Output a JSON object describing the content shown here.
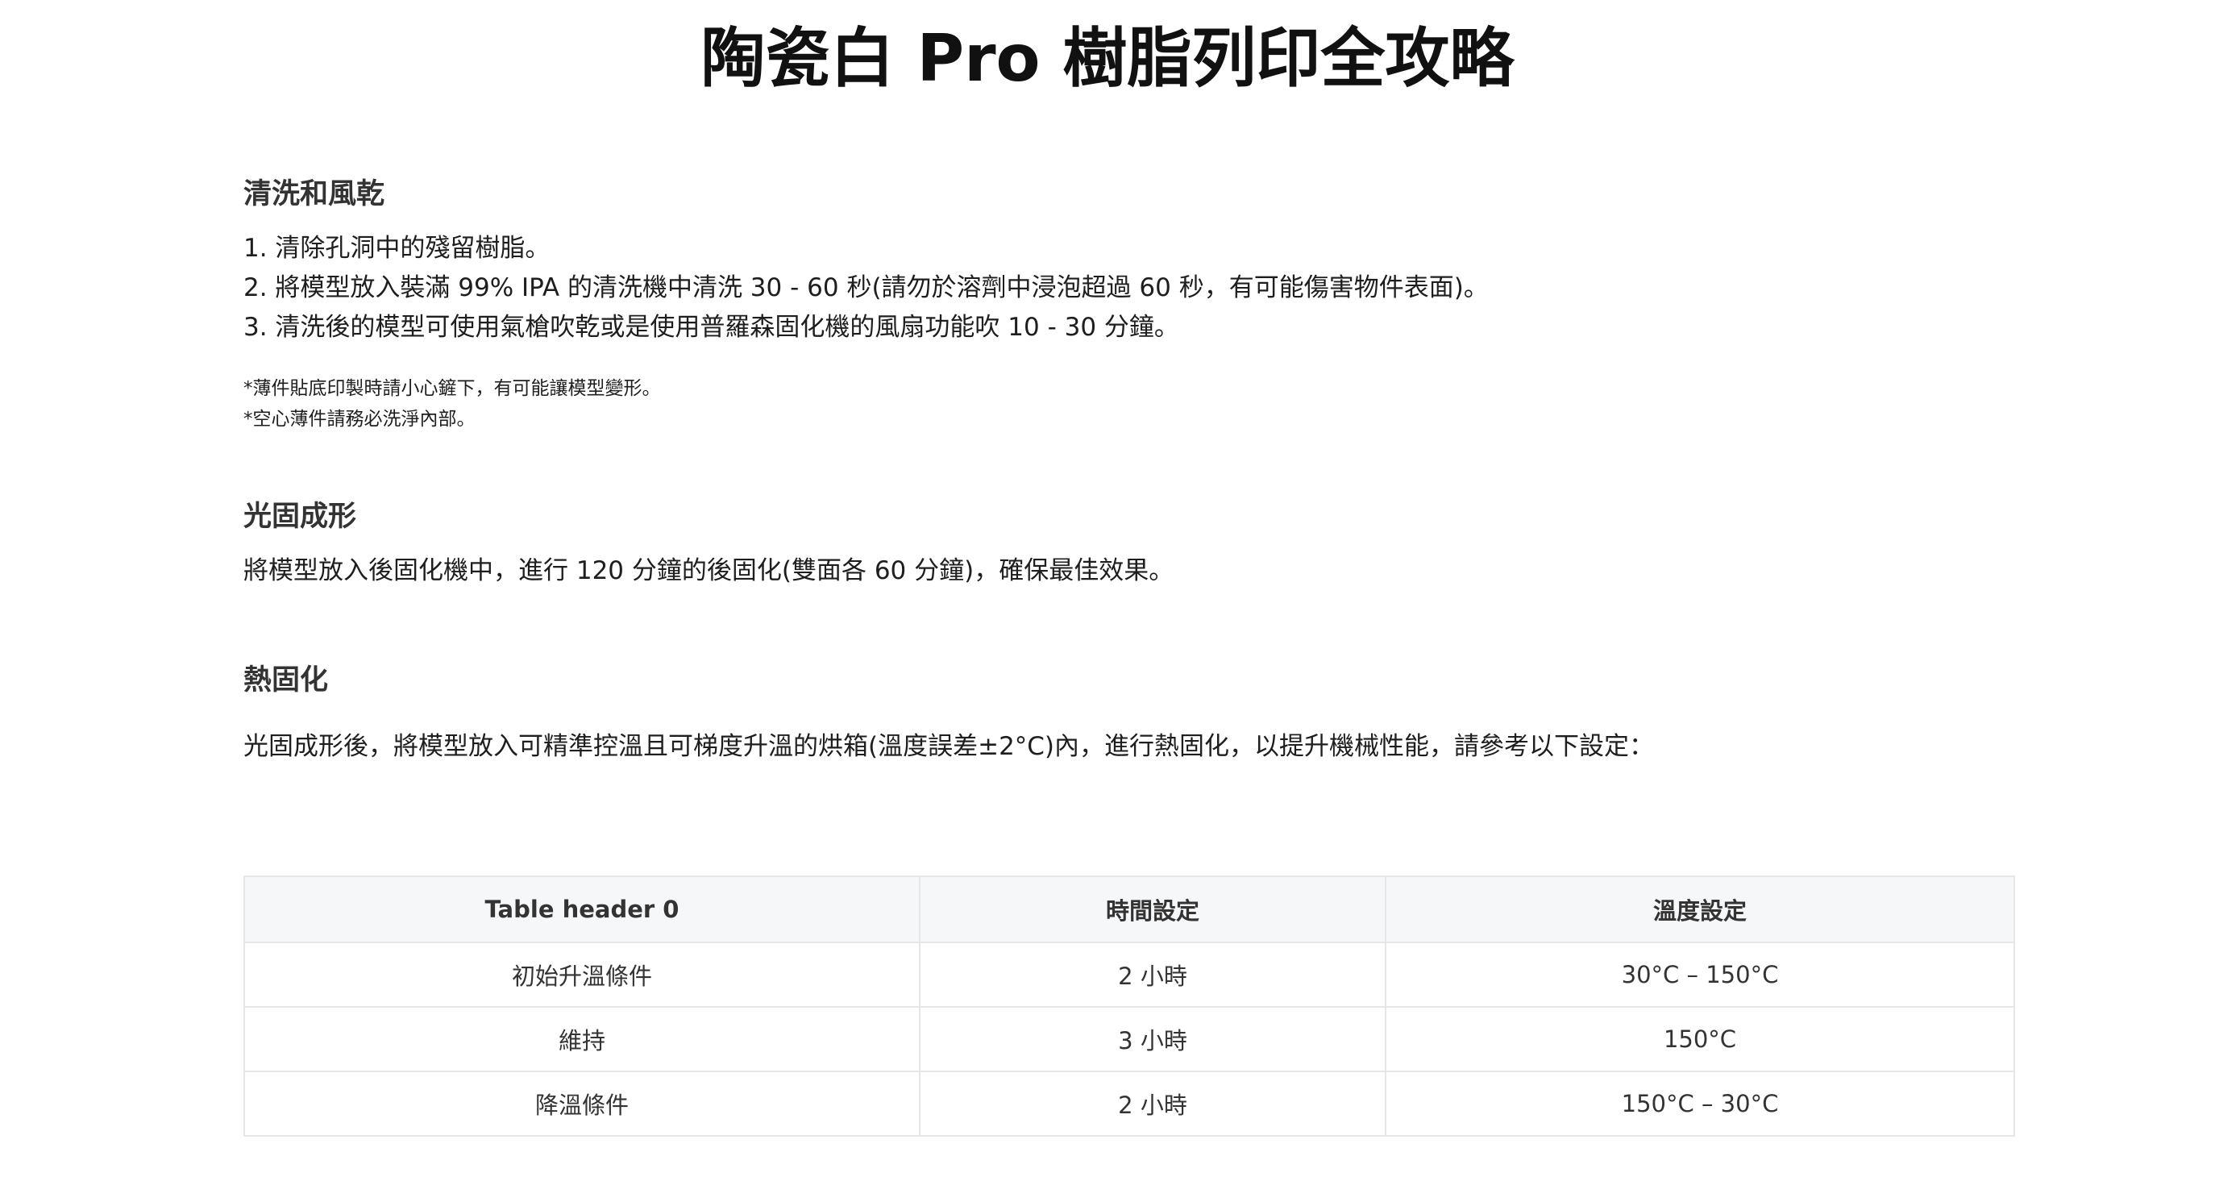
{
  "title": "陶瓷白 Pro 樹脂列印全攻略",
  "sections": {
    "wash": {
      "heading": "清洗和風乾",
      "steps": [
        "1. 清除孔洞中的殘留樹脂。",
        "2. 將模型放入裝滿 99% IPA 的清洗機中清洗 30 - 60 秒(請勿於溶劑中浸泡超過 60 秒，有可能傷害物件表面)。",
        "3. 清洗後的模型可使用氣槍吹乾或是使用普羅森固化機的風扇功能吹 10 - 30 分鐘。"
      ],
      "notes": [
        "*薄件貼底印製時請小心鏟下，有可能讓模型變形。",
        "*空心薄件請務必洗淨內部。"
      ]
    },
    "uv_cure": {
      "heading": "光固成形",
      "text": "將模型放入後固化機中，進行 120 分鐘的後固化(雙面各 60 分鐘)，確保最佳效果。"
    },
    "heat_cure": {
      "heading": "熱固化",
      "text": "光固成形後，將模型放入可精準控溫且可梯度升溫的烘箱(溫度誤差±2°C)內，進行熱固化，以提升機械性能，請參考以下設定："
    }
  },
  "table": {
    "headers": [
      "Table header 0",
      "時間設定",
      "溫度設定"
    ],
    "rows": [
      [
        "初始升溫條件",
        "2 小時",
        "30°C – 150°C"
      ],
      [
        "維持",
        "3 小時",
        "150°C"
      ],
      [
        "降溫條件",
        "2 小時",
        "150°C – 30°C"
      ]
    ]
  }
}
